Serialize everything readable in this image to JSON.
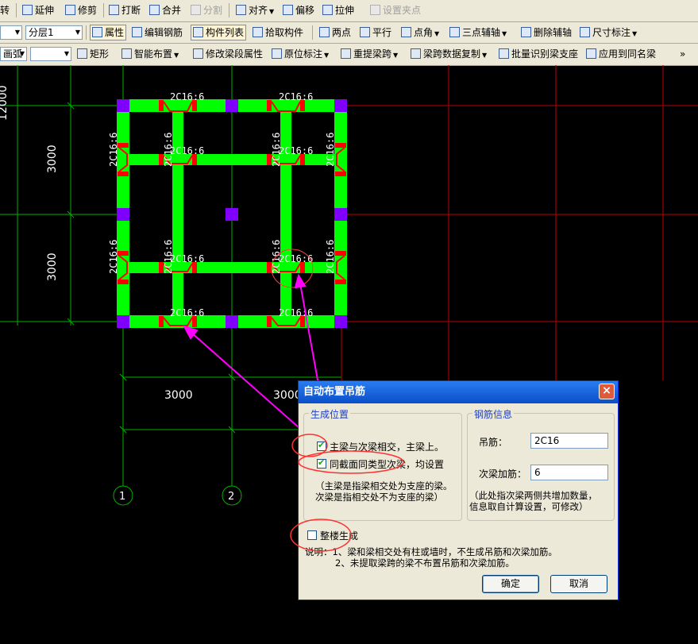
{
  "toolbar_row1": {
    "items": [
      "转",
      "延伸",
      "修剪",
      "打断",
      "合并",
      "分割",
      "对齐",
      "偏移",
      "拉伸",
      "设置夹点"
    ]
  },
  "toolbar_row2": {
    "floor_value": "分层1",
    "items": [
      "属性",
      "编辑钢筋",
      "构件列表",
      "拾取构件",
      "两点",
      "平行",
      "点角",
      "三点辅轴",
      "删除辅轴",
      "尺寸标注"
    ]
  },
  "toolbar_row3": {
    "arc_value": "画弧",
    "items": [
      "矩形",
      "智能布置",
      "修改梁段属性",
      "原位标注",
      "重提梁跨",
      "梁跨数据复制",
      "批量识别梁支座",
      "应用到同名梁"
    ],
    "more": "»"
  },
  "canvas": {
    "dims": {
      "left_upper": "3000",
      "left_lower": "3000",
      "bottom_1": "3000",
      "bottom_2": "3000",
      "top_left_partial": "12000"
    },
    "axis_labels": [
      "1",
      "2"
    ],
    "rebar_label": "2C16:6",
    "colors": {
      "beam": "#00ff00",
      "column": "#8000ff",
      "rebar": "#ff0000",
      "grid_green": "#00c000",
      "grid_red": "#c00000",
      "arrow": "#ff00ff"
    }
  },
  "dialog": {
    "title": "自动布置吊筋",
    "close": "×",
    "position_group": {
      "label": "生成位置",
      "option1": "主梁与次梁相交，主梁上。",
      "option1_checked": true,
      "option2": "同截面同类型次梁，均设置",
      "option2_checked": true,
      "note_line1": "（主梁是指梁相交处为支座的梁。",
      "note_line2": "次梁是指相交处不为支座的梁）"
    },
    "rebar_group": {
      "label": "钢筋信息",
      "hanger_label": "吊筋：",
      "hanger_value": "2C16",
      "extra_label": "次梁加筋：",
      "extra_value": "6",
      "note_line1": "（此处指次梁两侧共增加数量，",
      "note_line2": "信息取自计算设置，可修改）"
    },
    "whole_building": "整楼生成",
    "whole_building_checked": false,
    "desc_line1": "说明：1、梁和梁相交处有柱或墙时，不生成吊筋和次梁加筋。",
    "desc_line2": "2、未提取梁跨的梁不布置吊筋和次梁加筋。",
    "ok": "确定",
    "cancel": "取消"
  }
}
